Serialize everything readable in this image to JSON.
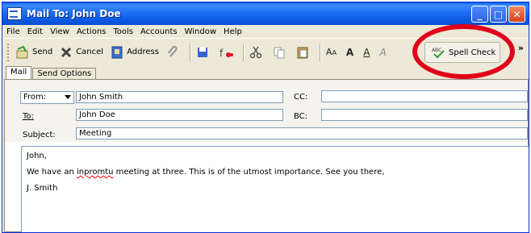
{
  "window": {
    "title": "Mail To: John Doe"
  },
  "menu": [
    "File",
    "Edit",
    "View",
    "Actions",
    "Tools",
    "Accounts",
    "Window",
    "Help"
  ],
  "toolbar": {
    "send": "Send",
    "cancel": "Cancel",
    "address": "Address",
    "spell_check": "Spell Check",
    "more": "»"
  },
  "tabs": [
    "Mail",
    "Send Options"
  ],
  "header": {
    "from_select": "From:",
    "from_value": "John Smith",
    "cc_label": "CC:",
    "cc_value": "",
    "to_label": "To:",
    "to_value": "John Doe",
    "bc_label": "BC:",
    "bc_value": "",
    "subject_label": "Subject:",
    "subject_value": "Meeting"
  },
  "message": {
    "greeting": "John,",
    "line_before": "We have an ",
    "misspelled": "inpromtu",
    "line_after": " meeting at three.  This is of the utmost importance.  See you there,",
    "signature": "J. Smith"
  },
  "colors": {
    "title_bar": "#0b58e0",
    "highlight_ring": "#e0001a",
    "window_bg": "#ece9d8"
  }
}
